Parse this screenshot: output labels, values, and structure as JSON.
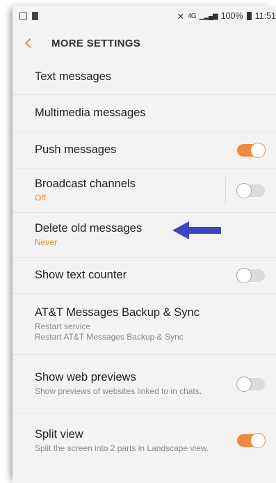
{
  "status_bar": {
    "signal_text": "4G",
    "battery": "100%",
    "time": "11:51"
  },
  "app_bar": {
    "title": "MORE SETTINGS",
    "back_icon": "chevron-left-icon"
  },
  "colors": {
    "accent": "#f08a24",
    "arrow": "#3b46c4"
  },
  "settings": [
    {
      "label": "Text messages"
    },
    {
      "label": "Multimedia messages"
    },
    {
      "label": "Push messages",
      "toggle": "on"
    },
    {
      "label": "Broadcast channels",
      "sub": "Off",
      "toggle": "off"
    },
    {
      "label": "Delete old messages",
      "sub": "Never"
    },
    {
      "label": "Show text counter",
      "toggle": "off"
    },
    {
      "label": "AT&T Messages Backup & Sync",
      "sub": "Restart service",
      "sub2": "Restart AT&T Messages Backup & Sync"
    },
    {
      "label": "Show web previews",
      "sub": "Show previews of websites linked to in chats.",
      "toggle": "off"
    },
    {
      "label": "Split view",
      "sub": "Split the screen into 2 parts in Landscape view.",
      "toggle": "on"
    }
  ]
}
